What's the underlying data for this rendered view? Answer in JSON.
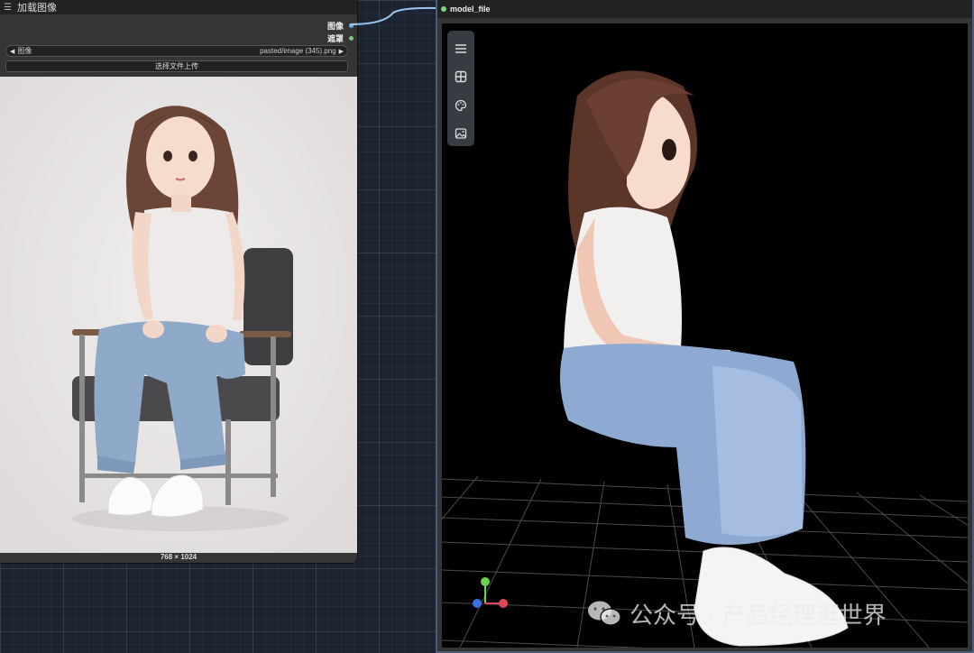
{
  "load_node": {
    "title": "加载图像",
    "outputs": [
      {
        "label": "图像",
        "color": "#64b5f6"
      },
      {
        "label": "遮罩",
        "color": "#81c784"
      }
    ],
    "image_widget": {
      "label": "图像",
      "value": "pasted/image (345).png"
    },
    "upload_button": "选择文件上传",
    "dimensions": "768 × 1024"
  },
  "view_node": {
    "title": "model_file",
    "title_dot_color": "#7cd77c",
    "toolbar": [
      {
        "icon": "menu-icon"
      },
      {
        "icon": "grid-layout-icon"
      },
      {
        "icon": "palette-icon"
      },
      {
        "icon": "image-icon"
      }
    ]
  },
  "watermark": {
    "platform": "公众号",
    "separator": "·",
    "account": "产品经理逛世界"
  }
}
